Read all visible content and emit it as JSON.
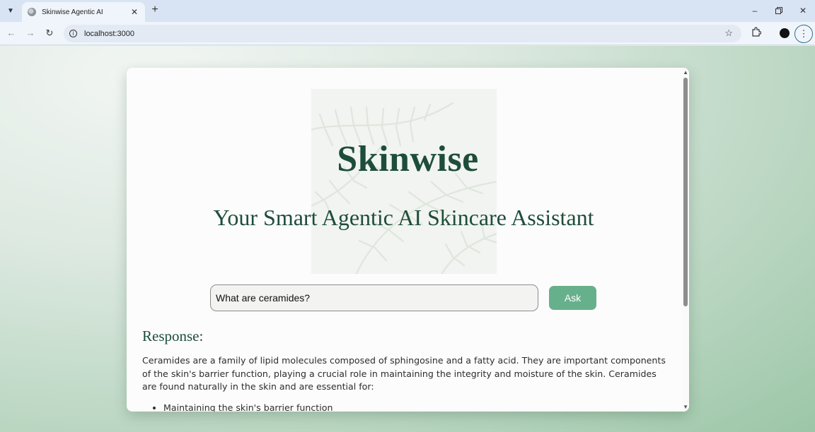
{
  "browser": {
    "tab_title": "Skinwise Agentic AI",
    "url": "localhost:3000",
    "icons": {
      "tab_search": "chevron-down-icon",
      "favicon": "globe-icon",
      "close": "close-icon",
      "new_tab": "plus-icon",
      "back": "arrow-left-icon",
      "forward": "arrow-right-icon",
      "reload": "reload-icon",
      "site_info": "info-icon",
      "bookmark": "star-icon",
      "extensions": "puzzle-icon",
      "profile": "profile-icon",
      "menu": "kebab-menu-icon",
      "minimize": "minimize-icon",
      "restore": "restore-icon",
      "window_close": "close-icon"
    }
  },
  "app": {
    "brand": "Skinwise",
    "tagline": "Your Smart Agentic AI Skincare Assistant",
    "query_value": "What are ceramides?",
    "ask_label": "Ask",
    "response_title": "Response:",
    "response_text": "Ceramides are a family of lipid molecules composed of sphingosine and a fatty acid. They are important components of the skin's barrier function, playing a crucial role in maintaining the integrity and moisture of the skin. Ceramides are found naturally in the skin and are essential for:",
    "response_items": [
      "Maintaining the skin's barrier function"
    ]
  },
  "colors": {
    "brand_green": "#1e4d3a",
    "button_green": "#67b08c",
    "page_gradient_end": "#9cc6a7"
  }
}
